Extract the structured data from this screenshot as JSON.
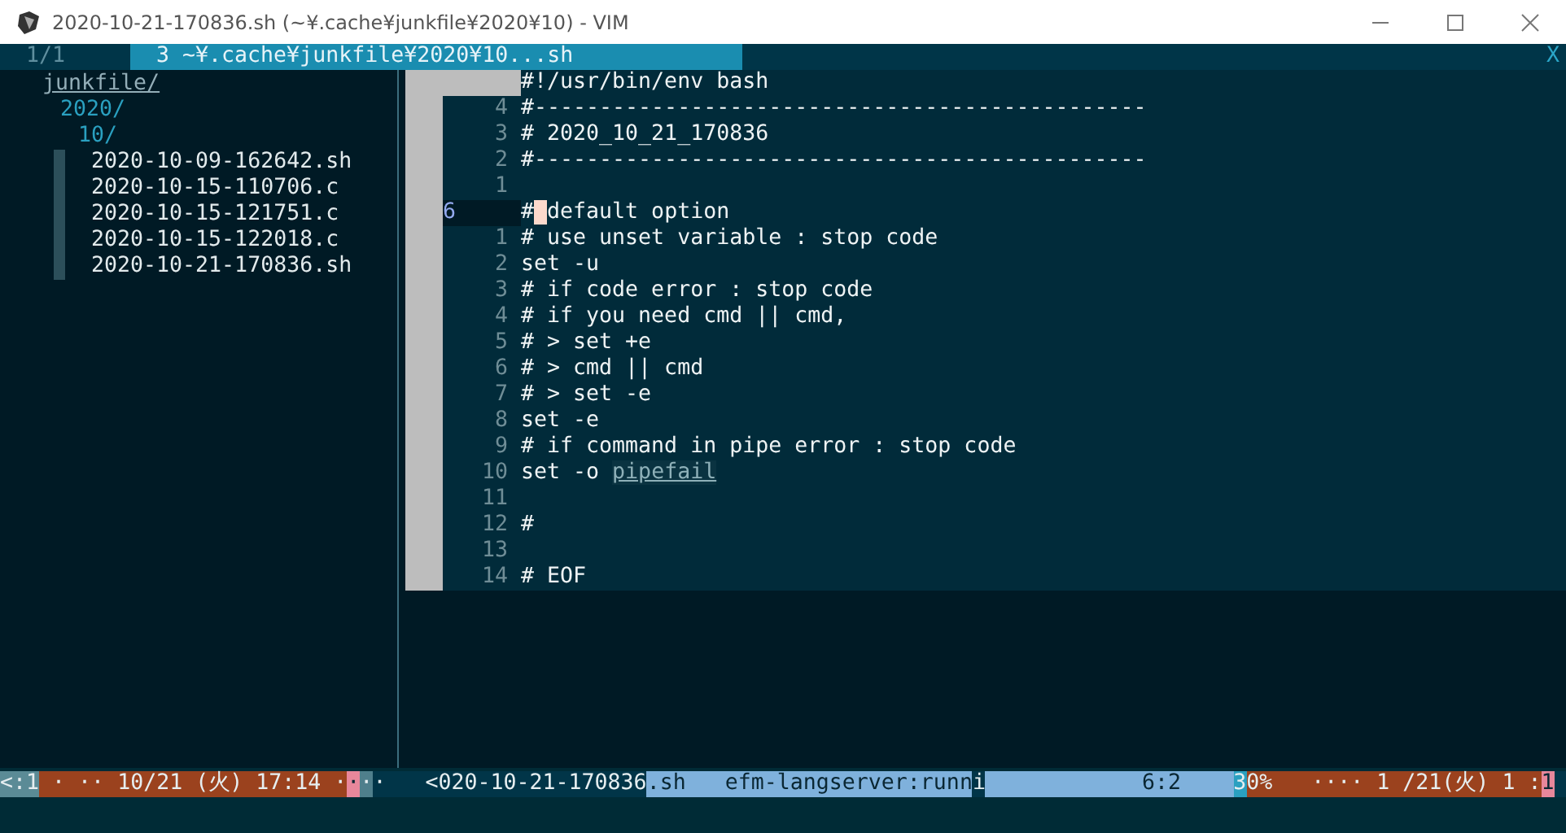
{
  "window": {
    "title": "2020-10-21-170836.sh (~¥.cache¥junkfile¥2020¥10) - VIM"
  },
  "tabline": {
    "tabs": [
      {
        "label": "1/1",
        "selected": false
      },
      {
        "label": "3 ~¥.cache¥junkfile¥2020¥10...sh",
        "selected": true
      }
    ],
    "close": "X"
  },
  "tree": [
    {
      "name": "junkfile/",
      "kind": "dir",
      "children": [
        {
          "name": "2020/",
          "kind": "dir",
          "children": [
            {
              "name": "10/",
              "kind": "dir",
              "children": [
                {
                  "name": "2020-10-09-162642.sh",
                  "kind": "file"
                },
                {
                  "name": "2020-10-15-110706.c",
                  "kind": "file"
                },
                {
                  "name": "2020-10-15-121751.c",
                  "kind": "file"
                },
                {
                  "name": "2020-10-15-122018.c",
                  "kind": "file"
                },
                {
                  "name": "2020-10-21-170836.sh",
                  "kind": "file"
                }
              ]
            }
          ]
        }
      ]
    }
  ],
  "editor": {
    "lines": [
      {
        "text": "#!/usr/bin/env bash",
        "current": false
      },
      {
        "number": "4",
        "text": "#-----------------------------------------------",
        "current": false
      },
      {
        "number": "3",
        "text": "# 2020_10_21_170836",
        "current": false
      },
      {
        "number": "2",
        "text": "#-----------------------------------------------",
        "current": false
      },
      {
        "number": "1",
        "current": false
      },
      {
        "number": "6",
        "text": "#",
        "cursor": true,
        "text_after": "default option",
        "current": true
      },
      {
        "number": "1",
        "text": "# use unset variable : stop code",
        "current": false
      },
      {
        "number": "2",
        "text": "set -u",
        "current": false
      },
      {
        "number": "3",
        "text": "# if code error : stop code",
        "current": false
      },
      {
        "number": "4",
        "text": "# if you need cmd || cmd,",
        "current": false
      },
      {
        "number": "5",
        "text": "# > set +e",
        "current": false
      },
      {
        "number": "6",
        "text": "# > cmd || cmd",
        "current": false
      },
      {
        "number": "7",
        "text": "# > set -e",
        "current": false
      },
      {
        "number": "8",
        "text": "set -e",
        "current": false
      },
      {
        "number": "9",
        "text": "# if command in pipe error : stop code",
        "current": false
      },
      {
        "number": "10",
        "text": "set -o ",
        "underlined": "pipefail",
        "current": false
      },
      {
        "number": "11",
        "current": false
      },
      {
        "number": "12",
        "text": "#",
        "current": false
      },
      {
        "number": "13",
        "current": false
      },
      {
        "number": "14",
        "text": "# EOF",
        "current": false
      }
    ]
  },
  "status_line": [
    {
      "text": "<:1",
      "color": "#5b8b96"
    },
    {
      "text": " · ·· 10/21 (火) 17:14 ·",
      "color": "#9b421e"
    },
    {
      "text": "·",
      "color": "#e8879b"
    },
    {
      "text": "·",
      "color": "#4f7f8c"
    },
    {
      "text": "·   <020-10-21-170836",
      "color": "#013548"
    },
    {
      "text": ".sh   efm-langserver:runn",
      "color": "#7fb1dc"
    },
    {
      "text": "i",
      "color": "#013548"
    },
    {
      "text": "            6:2    ",
      "color": "#7fb1dc"
    },
    {
      "text": "3",
      "color": "#2aa0c0"
    },
    {
      "text": "0%   ···· 1 /21(火) 1 :",
      "color": "#9b421e"
    },
    {
      "text": "1",
      "color": "#e8879b"
    }
  ]
}
